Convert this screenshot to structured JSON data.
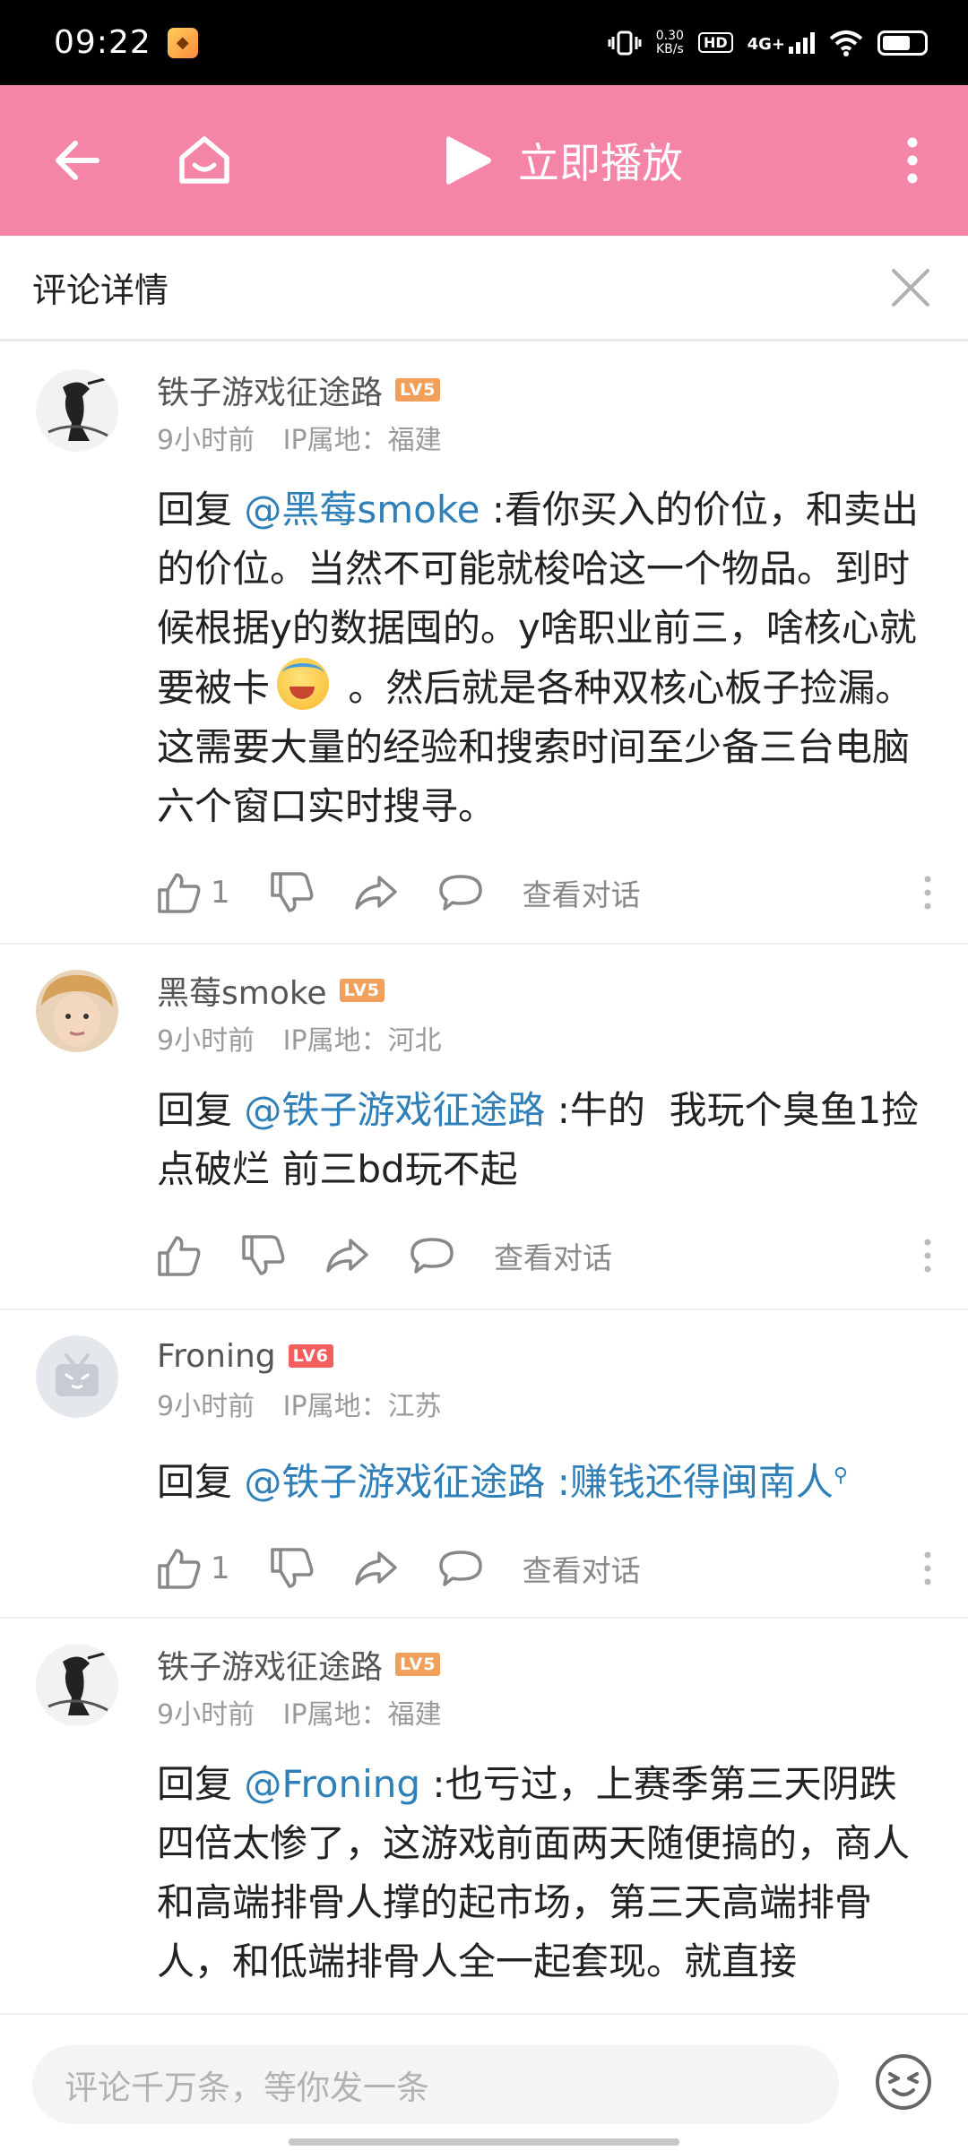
{
  "status_bar": {
    "time": "09:22",
    "net_speed_value": "0.30",
    "net_speed_unit": "KB/s",
    "hd_label": "HD",
    "network_label": "4G+"
  },
  "top_bar": {
    "play_label": "立即播放",
    "background_color": "#f585a6"
  },
  "detail_header": {
    "title": "评论详情"
  },
  "comments": [
    {
      "user_name": "铁子游戏征途路",
      "level": "LV5",
      "level_color": "#f0a05a",
      "time": "9小时前",
      "ip_location": "IP属地：福建",
      "reply_prefix": "回复 ",
      "mention": "@黑莓smoke",
      "text_before_emoji": " :看你买入的价位，和卖出的价位。当然不可能就梭哈这一个物品。到时候根据y的数据囤的。y啥职业前三，啥核心就要被卡",
      "text_after_emoji": " 。然后就是各种双核心板子捡漏。这需要大量的经验和搜索时间至少备三台电脑六个窗口实时搜寻。",
      "like_count": "1",
      "view_dialog_label": "查看对话"
    },
    {
      "user_name": "黑莓smoke",
      "level": "LV5",
      "level_color": "#f0a05a",
      "time": "9小时前",
      "ip_location": "IP属地：河北",
      "reply_prefix": "回复 ",
      "mention": "@铁子游戏征途路",
      "text": " :牛的  我玩个臭鱼1捡点破烂 前三bd玩不起",
      "like_count": "",
      "view_dialog_label": "查看对话"
    },
    {
      "user_name": "Froning",
      "level": "LV6",
      "level_color": "#f25d5d",
      "time": "9小时前",
      "ip_location": "IP属地：江苏",
      "reply_prefix": "回复 ",
      "mention": "@铁子游戏征途路",
      "text_link": " :赚钱还得闽南人",
      "search_mark": "⚲",
      "like_count": "1",
      "view_dialog_label": "查看对话"
    },
    {
      "user_name": "铁子游戏征途路",
      "level": "LV5",
      "level_color": "#f0a05a",
      "time": "9小时前",
      "ip_location": "IP属地：福建",
      "reply_prefix": "回复 ",
      "mention": "@Froning",
      "text": " :也亏过，上赛季第三天阴跌四倍太惨了，这游戏前面两天随便搞的，商人和高端排骨人撑的起市场，第三天高端排骨人，和低端排骨人全一起套现。就直接"
    }
  ],
  "bottom_bar": {
    "input_placeholder": "评论千万条，等你发一条"
  },
  "icons": {
    "back": "arrow-left-icon",
    "home": "home-face-icon",
    "play": "play-icon",
    "more": "more-vertical-icon",
    "close": "close-icon",
    "like": "thumbs-up-icon",
    "dislike": "thumbs-down-icon",
    "share": "share-icon",
    "reply": "chat-bubble-icon",
    "emoji": "emoji-icon"
  }
}
